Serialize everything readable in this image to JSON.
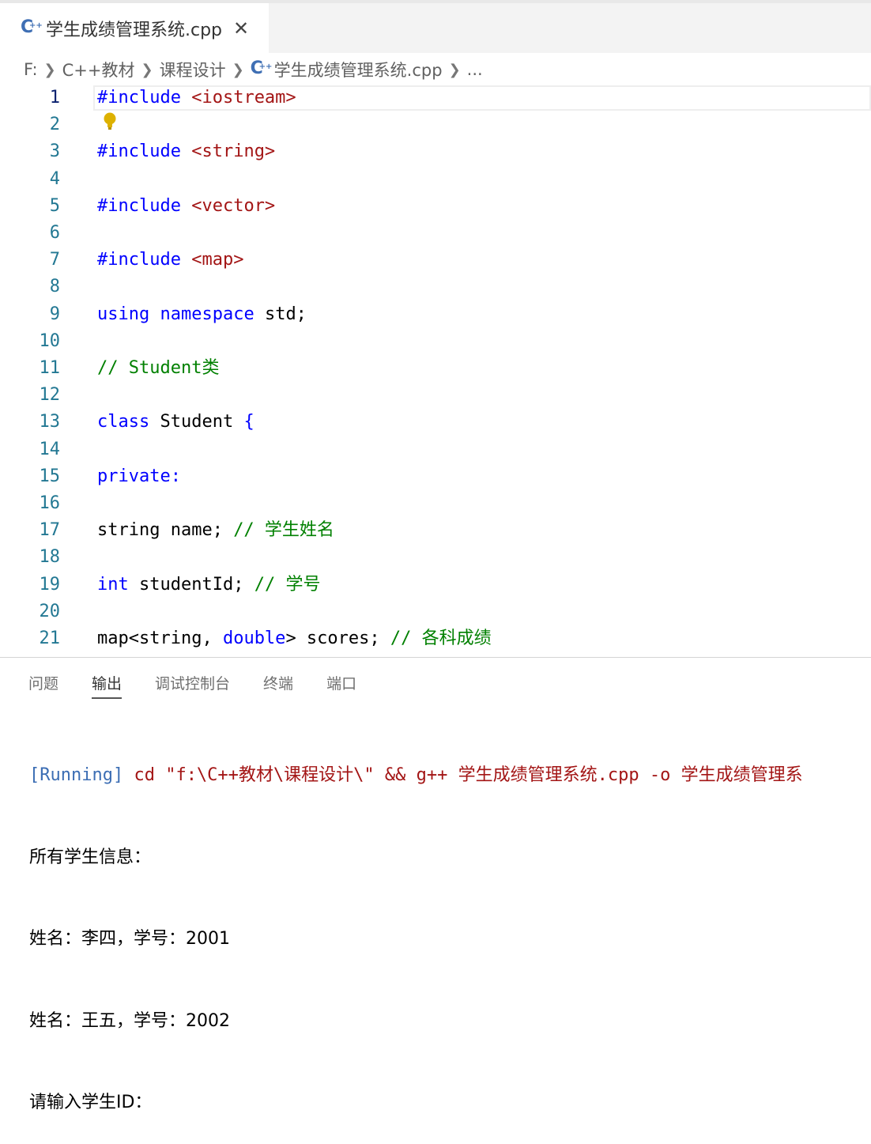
{
  "tab": {
    "title": "学生成绩管理系统.cpp",
    "close_glyph": "✕",
    "icon": "cpp-file-icon"
  },
  "breadcrumb": {
    "items": [
      "F:",
      "C++教材",
      "课程设计",
      "学生成绩管理系统.cpp",
      "..."
    ]
  },
  "editor": {
    "active_line": 1,
    "lines": [
      {
        "n": "1",
        "tokens": [
          {
            "t": "#include",
            "c": "kw"
          },
          {
            "t": " "
          },
          {
            "t": "<iostream>",
            "c": "str"
          }
        ]
      },
      {
        "n": "2",
        "tokens": []
      },
      {
        "n": "3",
        "tokens": [
          {
            "t": "#include",
            "c": "kw"
          },
          {
            "t": " "
          },
          {
            "t": "<string>",
            "c": "str"
          }
        ]
      },
      {
        "n": "4",
        "tokens": []
      },
      {
        "n": "5",
        "tokens": [
          {
            "t": "#include",
            "c": "kw"
          },
          {
            "t": " "
          },
          {
            "t": "<vector>",
            "c": "str"
          }
        ]
      },
      {
        "n": "6",
        "tokens": []
      },
      {
        "n": "7",
        "tokens": [
          {
            "t": "#include",
            "c": "kw"
          },
          {
            "t": " "
          },
          {
            "t": "<map>",
            "c": "str"
          }
        ]
      },
      {
        "n": "8",
        "tokens": []
      },
      {
        "n": "9",
        "tokens": [
          {
            "t": "using",
            "c": "kw"
          },
          {
            "t": " "
          },
          {
            "t": "namespace",
            "c": "kw"
          },
          {
            "t": " std;"
          }
        ]
      },
      {
        "n": "10",
        "tokens": []
      },
      {
        "n": "11",
        "tokens": [
          {
            "t": "// Student类",
            "c": "cmt"
          }
        ]
      },
      {
        "n": "12",
        "tokens": []
      },
      {
        "n": "13",
        "tokens": [
          {
            "t": "class",
            "c": "kw"
          },
          {
            "t": " Student "
          },
          {
            "t": "{",
            "c": "kw"
          }
        ]
      },
      {
        "n": "14",
        "tokens": []
      },
      {
        "n": "15",
        "tokens": [
          {
            "t": "private:",
            "c": "kw"
          }
        ]
      },
      {
        "n": "16",
        "tokens": []
      },
      {
        "n": "17",
        "tokens": [
          {
            "t": "string name; "
          },
          {
            "t": "// 学生姓名",
            "c": "cmt"
          }
        ]
      },
      {
        "n": "18",
        "tokens": []
      },
      {
        "n": "19",
        "tokens": [
          {
            "t": "int",
            "c": "kw"
          },
          {
            "t": " studentId; "
          },
          {
            "t": "// 学号",
            "c": "cmt"
          }
        ]
      },
      {
        "n": "20",
        "tokens": []
      },
      {
        "n": "21",
        "tokens": [
          {
            "t": "map<string, "
          },
          {
            "t": "double",
            "c": "kw"
          },
          {
            "t": "> scores; "
          },
          {
            "t": "// 各科成绩",
            "c": "cmt"
          }
        ]
      }
    ]
  },
  "panel": {
    "tabs": [
      "问题",
      "输出",
      "调试控制台",
      "终端",
      "端口"
    ],
    "active_tab": "输出"
  },
  "output": {
    "running_tag": "[Running]",
    "running_cmd": " cd \"f:\\C++教材\\课程设计\\\" && g++ 学生成绩管理系统.cpp -o 学生成绩管理系",
    "lines": [
      "所有学生信息：",
      "姓名：李四，学号：2001",
      "姓名：王五，学号：2002",
      "请输入学生ID："
    ]
  },
  "colors": {
    "keyword": "#0000ff",
    "string": "#a31515",
    "comment": "#008000",
    "line_number": "#237893",
    "running_tag": "#3c6eb4"
  }
}
